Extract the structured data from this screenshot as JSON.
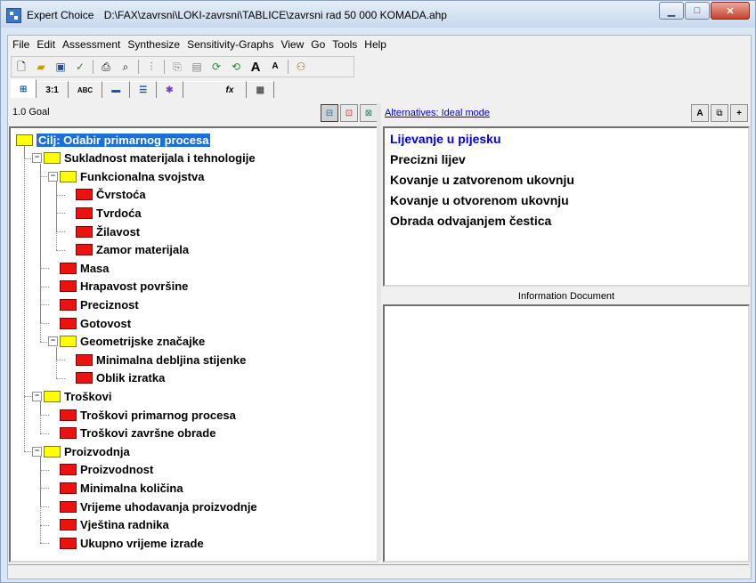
{
  "window": {
    "app_title": "Expert Choice",
    "file_path": "D:\\FAX\\zavrsni\\LOKI-zavrsni\\TABLICE\\zavrsni rad  50 000 KOMADA.ahp"
  },
  "menu": [
    "File",
    "Edit",
    "Assessment",
    "Synthesize",
    "Sensitivity-Graphs",
    "View",
    "Go",
    "Tools",
    "Help"
  ],
  "view_tabs": {
    "ratio_label": "3:1",
    "abc_label": "ABC",
    "formula_label": "fx"
  },
  "tree_header": {
    "node_label": "1.0 Goal"
  },
  "tree": [
    {
      "label": "Cilj: Odabir primarnog procesa",
      "type": "goal",
      "level": 0
    },
    {
      "label": "Sukladnost materijala i tehnologije",
      "type": "cat",
      "level": 1
    },
    {
      "label": "Funkcionalna svojstva",
      "type": "cat",
      "level": 2
    },
    {
      "label": "Čvrstoća",
      "type": "leaf",
      "level": 3
    },
    {
      "label": "Tvrdoća",
      "type": "leaf",
      "level": 3
    },
    {
      "label": "Žilavost",
      "type": "leaf",
      "level": 3
    },
    {
      "label": "Zamor materijala",
      "type": "leaf",
      "level": 3
    },
    {
      "label": "Masa",
      "type": "leaf",
      "level": 2
    },
    {
      "label": "Hrapavost površine",
      "type": "leaf",
      "level": 2
    },
    {
      "label": "Preciznost",
      "type": "leaf",
      "level": 2
    },
    {
      "label": "Gotovost",
      "type": "leaf",
      "level": 2
    },
    {
      "label": "Geometrijske značajke",
      "type": "cat",
      "level": 2
    },
    {
      "label": "Minimalna debljina stijenke",
      "type": "leaf",
      "level": 3
    },
    {
      "label": "Oblik izratka",
      "type": "leaf",
      "level": 3
    },
    {
      "label": "Troškovi",
      "type": "cat",
      "level": 1
    },
    {
      "label": "Troškovi primarnog procesa",
      "type": "leaf",
      "level": 2
    },
    {
      "label": "Troškovi završne obrade",
      "type": "leaf",
      "level": 2
    },
    {
      "label": "Proizvodnja",
      "type": "cat",
      "level": 1
    },
    {
      "label": "Proizvodnost",
      "type": "leaf",
      "level": 2
    },
    {
      "label": "Minimalna količina",
      "type": "leaf",
      "level": 2
    },
    {
      "label": "Vrijeme uhodavanja proizvodnje",
      "type": "leaf",
      "level": 2
    },
    {
      "label": "Vještina radnika",
      "type": "leaf",
      "level": 2
    },
    {
      "label": "Ukupno vrijeme izrade",
      "type": "leaf",
      "level": 2
    }
  ],
  "alternatives_header": {
    "link": "Alternatives: Ideal mode"
  },
  "alternatives": [
    "Lijevanje u pijesku",
    "Precizni lijev",
    "Kovanje u zatvorenom ukovnju",
    "Kovanje u otvorenom ukovnju",
    "Obrada odvajanjem čestica"
  ],
  "info_document": {
    "title": "Information Document"
  }
}
